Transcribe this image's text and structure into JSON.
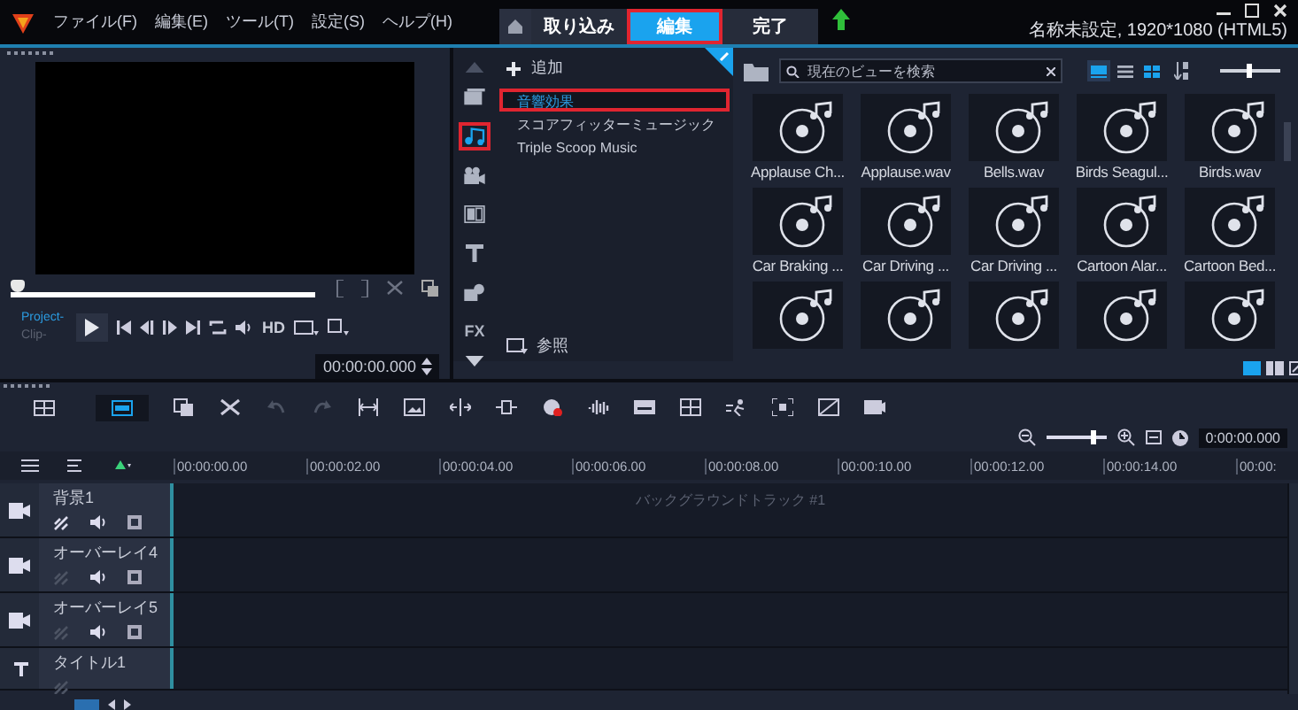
{
  "menu": [
    "ファイル(F)",
    "編集(E)",
    "ツール(T)",
    "設定(S)",
    "ヘルプ(H)"
  ],
  "tabs": [
    {
      "label": "取り込み",
      "selected": false
    },
    {
      "label": "編集",
      "selected": true
    },
    {
      "label": "完了",
      "selected": false
    }
  ],
  "title": "名称未設定, 1920*1080 (HTML5)",
  "player": {
    "scrubber": {
      "level": 0
    },
    "modes": [
      {
        "label": "Project-",
        "selected": true
      },
      {
        "label": "Clip-",
        "selected": false
      }
    ],
    "hd": "HD",
    "timecode": "00:00:00.000"
  },
  "library": {
    "add": "追加",
    "browse": "参照",
    "categories": [
      {
        "kind": "media",
        "selected": false
      },
      {
        "kind": "audio",
        "selected": true
      },
      {
        "kind": "instant",
        "selected": false
      },
      {
        "kind": "transition",
        "selected": false
      },
      {
        "kind": "title",
        "selected": false
      },
      {
        "kind": "graphics",
        "selected": false
      },
      {
        "kind": "filter",
        "label": "FX",
        "selected": false
      }
    ],
    "folders": [
      {
        "label": "音響効果",
        "selected": true
      },
      {
        "label": "スコアフィッターミュージック",
        "selected": false
      },
      {
        "label": "Triple Scoop Music",
        "selected": false
      }
    ],
    "search": {
      "placeholder": "現在のビューを検索"
    },
    "views": [
      {
        "kind": "thumbnails",
        "selected": true
      },
      {
        "kind": "list",
        "selected": false
      },
      {
        "kind": "grid",
        "selected": false
      }
    ],
    "size_slider": {
      "level": 0.45
    },
    "clips": [
      {
        "kind": "sound",
        "name": "Applause Ch..."
      },
      {
        "kind": "sound",
        "name": "Applause.wav"
      },
      {
        "kind": "sound",
        "name": "Bells.wav"
      },
      {
        "kind": "sound",
        "name": "Birds Seagul..."
      },
      {
        "kind": "sound",
        "name": "Birds.wav"
      },
      {
        "kind": "sound",
        "name": "Car Braking ..."
      },
      {
        "kind": "sound",
        "name": "Car Driving ..."
      },
      {
        "kind": "sound",
        "name": "Car Driving ..."
      },
      {
        "kind": "sound",
        "name": "Cartoon Alar..."
      },
      {
        "kind": "sound",
        "name": "Cartoon Bed..."
      },
      {
        "kind": "sound"
      },
      {
        "kind": "sound"
      },
      {
        "kind": "sound"
      },
      {
        "kind": "sound"
      },
      {
        "kind": "sound"
      }
    ]
  },
  "timeline": {
    "views": [
      {
        "kind": "storyboard",
        "selected": false
      },
      {
        "kind": "timeline",
        "selected": true
      }
    ],
    "zoom": {
      "level": 0.75
    },
    "timecode": "0:00:00.000",
    "ruler": [
      "00:00:00.00",
      "00:00:02.00",
      "00:00:04.00",
      "00:00:06.00",
      "00:00:08.00",
      "00:00:10.00",
      "00:00:12.00",
      "00:00:14.00",
      "00:00:"
    ],
    "tracks": [
      {
        "kind": "video",
        "name": "背景1",
        "link_enabled": true,
        "hint": "バックグラウンドトラック #1"
      },
      {
        "kind": "overlay",
        "name": "オーバーレイ4",
        "link_enabled": false
      },
      {
        "kind": "overlay",
        "name": "オーバーレイ5",
        "link_enabled": false
      },
      {
        "kind": "title",
        "name": "タイトル1",
        "link_enabled": false
      }
    ]
  }
}
